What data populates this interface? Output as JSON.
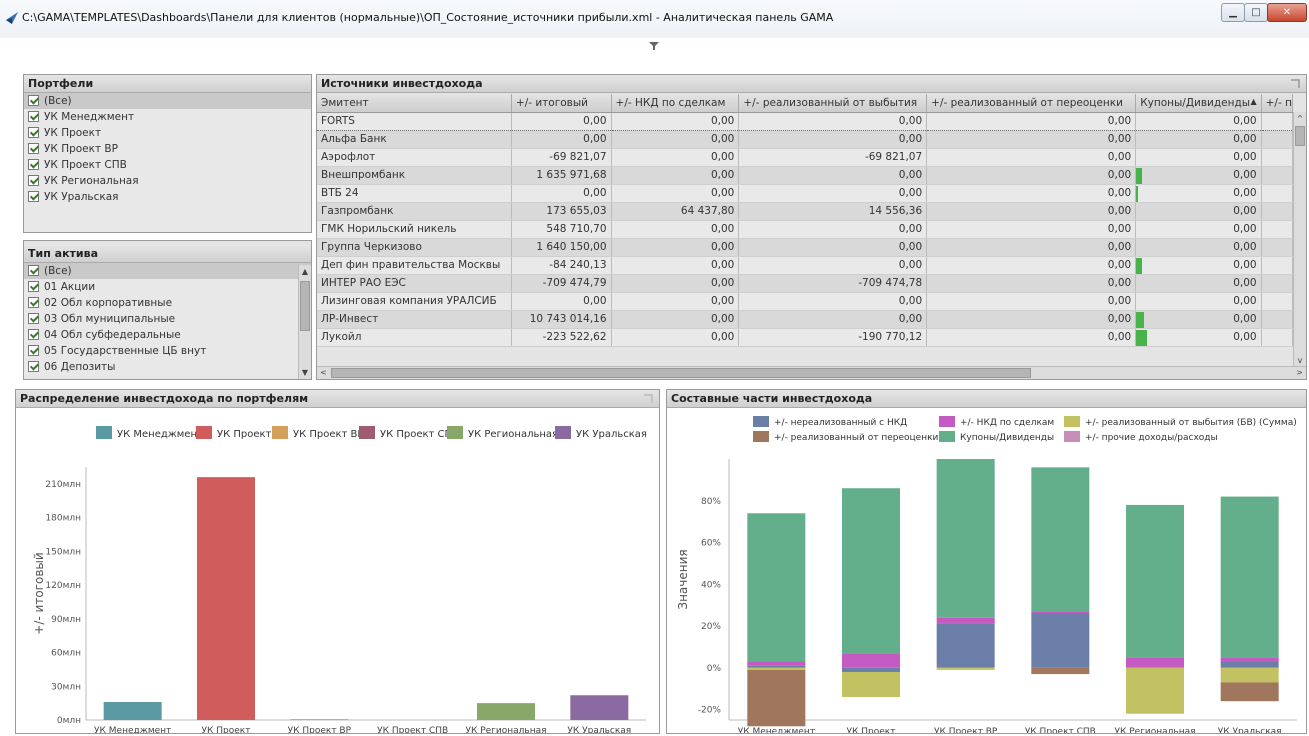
{
  "window": {
    "title": "C:\\GAMA\\TEMPLATES\\Dashboards\\Панели для клиентов (нормальные)\\ОП_Состояние_источники прибыли.xml - Аналитическая панель GAMA",
    "min_label": "▁",
    "max_label": "□",
    "close_label": "✕"
  },
  "portfolios": {
    "title": "Портфели",
    "items": [
      "(Все)",
      "УК Менеджмент",
      "УК Проект",
      "УК Проект ВР",
      "УК Проект СПВ",
      "УК Региональная",
      "УК Уральская"
    ]
  },
  "asset_types": {
    "title": "Тип актива",
    "items": [
      "(Все)",
      "01 Акции",
      "02 Обл корпоративные",
      "03 Обл муниципальные",
      "04 Обл субфедеральные",
      "05 Государственные ЦБ внут",
      "06 Депозиты"
    ]
  },
  "sources": {
    "title": "Источники инвестдохода",
    "columns": [
      "Эмитент",
      "+/- итоговый",
      "+/- НКД по сделкам",
      "+/- реализованный от выбытия",
      "+/- реализованный от переоценки",
      "Купоны/Дивиденды",
      "+/- п"
    ],
    "sort_arrow": "▲",
    "rows": [
      [
        "FORTS",
        "0,00",
        "0,00",
        "0,00",
        "0,00",
        "0,00"
      ],
      [
        "Альфа Банк",
        "0,00",
        "0,00",
        "0,00",
        "0,00",
        "0,00"
      ],
      [
        "Аэрофлот",
        "-69 821,07",
        "0,00",
        "-69 821,07",
        "0,00",
        "0,00"
      ],
      [
        "Внешпромбанк",
        "1 635 971,68",
        "0,00",
        "0,00",
        "0,00",
        "0,00"
      ],
      [
        "ВТБ 24",
        "0,00",
        "0,00",
        "0,00",
        "0,00",
        "0,00"
      ],
      [
        "Газпромбанк",
        "173 655,03",
        "64 437,80",
        "14 556,36",
        "0,00",
        "0,00"
      ],
      [
        "ГМК Норильский никель",
        "548 710,70",
        "0,00",
        "0,00",
        "0,00",
        "0,00"
      ],
      [
        "Группа Черкизово",
        "1 640 150,00",
        "0,00",
        "0,00",
        "0,00",
        "0,00"
      ],
      [
        "Деп фин правительства Москвы",
        "-84 240,13",
        "0,00",
        "0,00",
        "0,00",
        "0,00"
      ],
      [
        "ИНТЕР РАО ЕЭС",
        "-709 474,79",
        "0,00",
        "-709 474,78",
        "0,00",
        "0,00"
      ],
      [
        "Лизинговая компания УРАЛСИБ",
        "0,00",
        "0,00",
        "0,00",
        "0,00",
        "0,00"
      ],
      [
        "ЛР-Инвест",
        "10 743 014,16",
        "0,00",
        "0,00",
        "0,00",
        "0,00"
      ],
      [
        "Лукойл",
        "-223 522,62",
        "0,00",
        "-190 770,12",
        "0,00",
        "0,00"
      ]
    ],
    "kupon_bars": [
      0,
      0,
      0.04,
      0.4,
      0.1,
      0.02,
      0.04,
      0.03,
      0.4,
      0.02,
      0.04,
      0.5,
      0.7
    ]
  },
  "chart_data": [
    {
      "type": "bar",
      "title": "Распределение инвестдохода по портфелям",
      "ylabel": "+/- итоговый",
      "xlabel": "",
      "categories": [
        "УК Менеджмент",
        "УК Проект",
        "УК Проект ВР",
        "УК Проект СПВ",
        "УК Региональная",
        "УК Уральская"
      ],
      "values": [
        16,
        216,
        0.8,
        0,
        15,
        22
      ],
      "unit_note": "млн",
      "yticks": [
        "0млн",
        "30млн",
        "60млн",
        "90млн",
        "120млн",
        "150млн",
        "180млн",
        "210млн"
      ],
      "ylim": [
        0,
        225
      ],
      "colors": [
        "#5c9aa3",
        "#d05c5c",
        "#d2a05a",
        "#a05c6e",
        "#8aa76a",
        "#8a6aa0"
      ],
      "legend": [
        "УК Менеджмент",
        "УК Проект",
        "УК Проект ВР",
        "УК Проект СПВ",
        "УК Региональная",
        "УК Уральская"
      ],
      "legend_placement": "top",
      "grid": false
    },
    {
      "type": "bar",
      "stacked": true,
      "title": "Составные части инвестдохода",
      "ylabel": "Значения",
      "xlabel": "",
      "categories": [
        "УК Менеджмент",
        "УК Проект",
        "УК Проект ВР",
        "УК Проект СПВ",
        "УК Региональная",
        "УК Уральская"
      ],
      "yticks": [
        "-20%",
        "0%",
        "20%",
        "40%",
        "60%",
        "80%"
      ],
      "ylim": [
        -25,
        100
      ],
      "legend_placement": "top",
      "grid": false,
      "series": [
        {
          "name": "+/- нереализованный с НКД",
          "color": "#6a7ea8",
          "values": [
            1,
            -2,
            21,
            26,
            0,
            3
          ]
        },
        {
          "name": "+/- НКД по сделкам",
          "color": "#c35bc3",
          "values": [
            2,
            7,
            3,
            1,
            5,
            2
          ]
        },
        {
          "name": "+/- реализованный от выбытия (БВ) (Сумма)",
          "color": "#c2c262",
          "values": [
            -1,
            -12,
            -1,
            0,
            -22,
            -7
          ]
        },
        {
          "name": "+/- реализованный от переоценки",
          "color": "#a0765c",
          "values": [
            -27,
            0,
            0,
            -3,
            0,
            -9
          ]
        },
        {
          "name": "Купоны/Дивиденды",
          "color": "#63ae8b",
          "values": [
            71,
            79,
            76,
            69,
            73,
            77
          ]
        },
        {
          "name": "+/- прочие доходы/расходы",
          "color": "#c78fb4",
          "values": [
            0,
            0,
            0,
            0,
            0,
            0
          ]
        }
      ]
    }
  ]
}
